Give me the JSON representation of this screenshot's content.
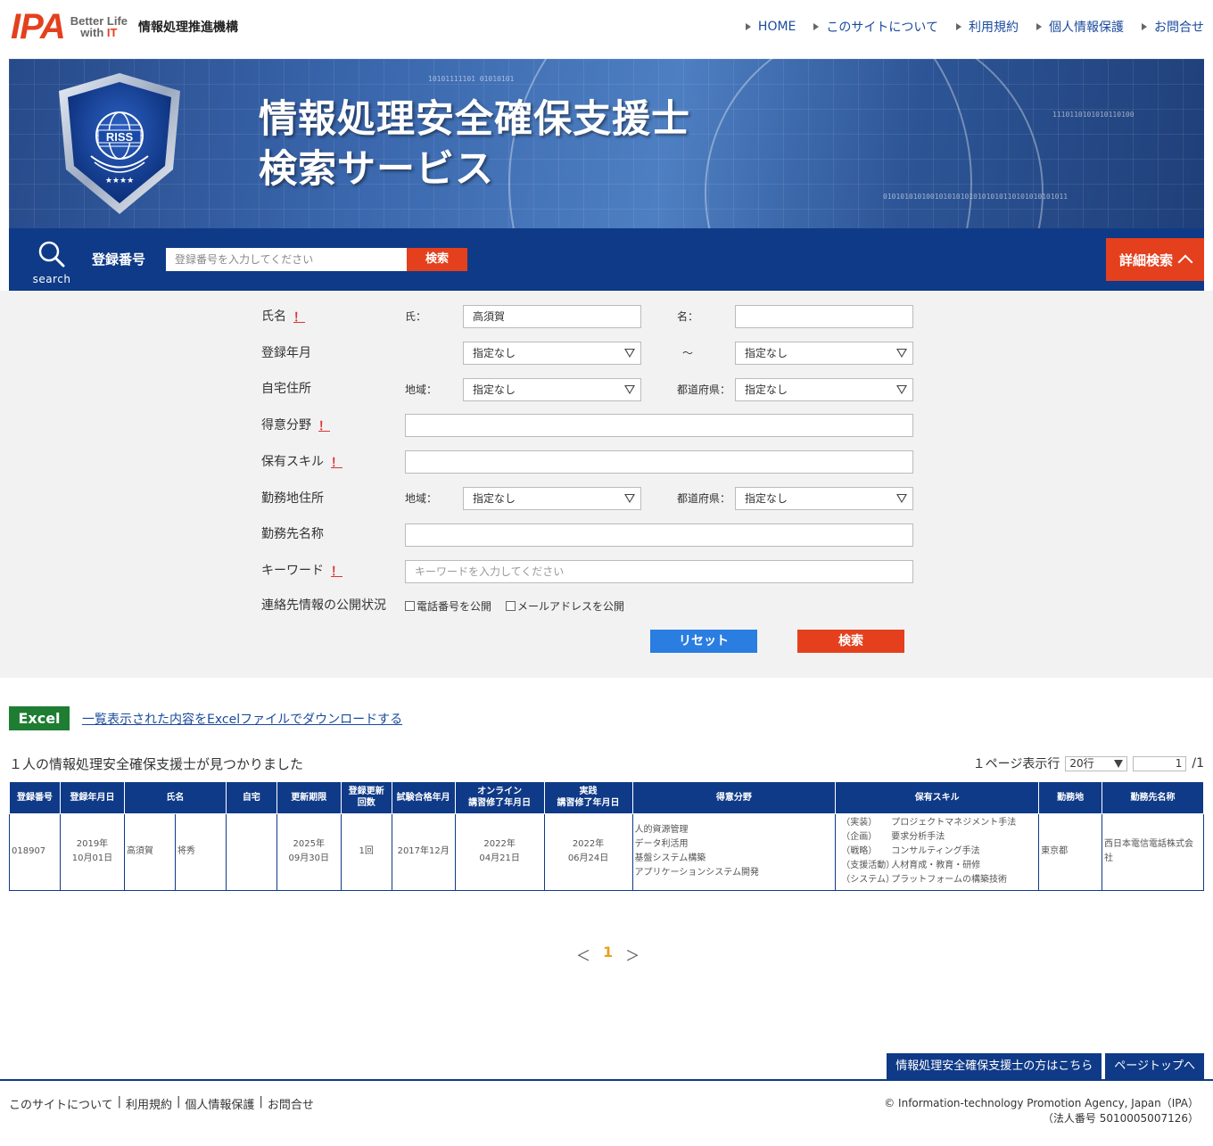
{
  "header": {
    "logo_text": "IPA",
    "logo_tag_line1": "Better Life",
    "logo_tag_with": "with ",
    "logo_tag_it": "IT",
    "org_name": "情報処理推進機構",
    "nav": [
      "HOME",
      "このサイトについて",
      "利用規約",
      "個人情報保護",
      "お問合せ"
    ]
  },
  "banner": {
    "title_line1": "情報処理安全確保支援士",
    "title_line2": "検索サービス",
    "emblem_text": "RISS"
  },
  "searchbar": {
    "icon_label": "search",
    "label": "登録番号",
    "placeholder": "登録番号を入力してください",
    "search_button": "検索",
    "detail_button": "詳細検索"
  },
  "form": {
    "name_label": "氏名",
    "last_label": "氏：",
    "last_value": "高須賀",
    "first_label": "名：",
    "first_value": "",
    "reg_label": "登録年月",
    "reg_from": "指定なし",
    "tilde": "～",
    "reg_to": "指定なし",
    "home_label": "自宅住所",
    "region_label": "地域：",
    "pref_label": "都道府県：",
    "home_region": "指定なし",
    "home_pref": "指定なし",
    "field_label": "得意分野",
    "skill_label": "保有スキル",
    "work_label": "勤務地住所",
    "work_region": "指定なし",
    "work_pref": "指定なし",
    "company_label": "勤務先名称",
    "keyword_label": "キーワード",
    "keyword_placeholder": "キーワードを入力してください",
    "contact_label": "連絡先情報の公開状況",
    "chk_phone": "電話番号を公開",
    "chk_mail": "メールアドレスを公開",
    "bang": "！",
    "reset_button": "リセット",
    "search_button": "検索"
  },
  "results": {
    "excel_badge": "Excel",
    "excel_link": "一覧表示された内容をExcelファイルでダウンロードする",
    "count_text": "１人の情報処理安全確保支援士が見つかりました",
    "per_page_label": "１ページ表示行",
    "per_page_value": "20行",
    "page_input": "1",
    "page_total": "/1",
    "headers": [
      "登録番号",
      "登録年月日",
      "氏名",
      "自宅",
      "更新期限",
      "登録更新\n回数",
      "試験合格年月",
      "オンライン\n講習修了年月日",
      "実践\n講習修了年月日",
      "得意分野",
      "保有スキル",
      "勤務地",
      "勤務先名称"
    ],
    "row": {
      "reg_no": "018907",
      "reg_date_y": "2019年",
      "reg_date_md": "10月01日",
      "last_name": "高須賀",
      "first_name": "将秀",
      "home": "",
      "expire_y": "2025年",
      "expire_md": "09月30日",
      "renewals": "1回",
      "exam": "2017年12月",
      "online_y": "2022年",
      "online_md": "04月21日",
      "practice_y": "2022年",
      "practice_md": "06月24日",
      "fields": [
        "人的資源管理",
        "データ利活用",
        "基盤システム構築",
        "アプリケーションシステム開発"
      ],
      "skills": [
        {
          "cat": "（実装）",
          "name": "プロジェクトマネジメント手法"
        },
        {
          "cat": "（企画）",
          "name": "要求分析手法"
        },
        {
          "cat": "（戦略）",
          "name": "コンサルティング手法"
        },
        {
          "cat": "（支援活動）",
          "name": "人材育成・教育・研修"
        },
        {
          "cat": "（システム）",
          "name": "プラットフォームの構築技術"
        }
      ],
      "work_place": "東京都",
      "company": "西日本電信電話株式会社"
    }
  },
  "pager": {
    "prev": "＜",
    "current": "1",
    "next": "＞"
  },
  "footer": {
    "btn_riss": "情報処理安全確保支援士の方はこちら",
    "btn_top": "ページトップへ",
    "links": [
      "このサイトについて",
      "利用規約",
      "個人情報保護",
      "お問合せ"
    ],
    "copyright": "© Information-technology Promotion Agency, Japan（IPA）",
    "corp_no": "（法人番号 5010005007126）"
  }
}
